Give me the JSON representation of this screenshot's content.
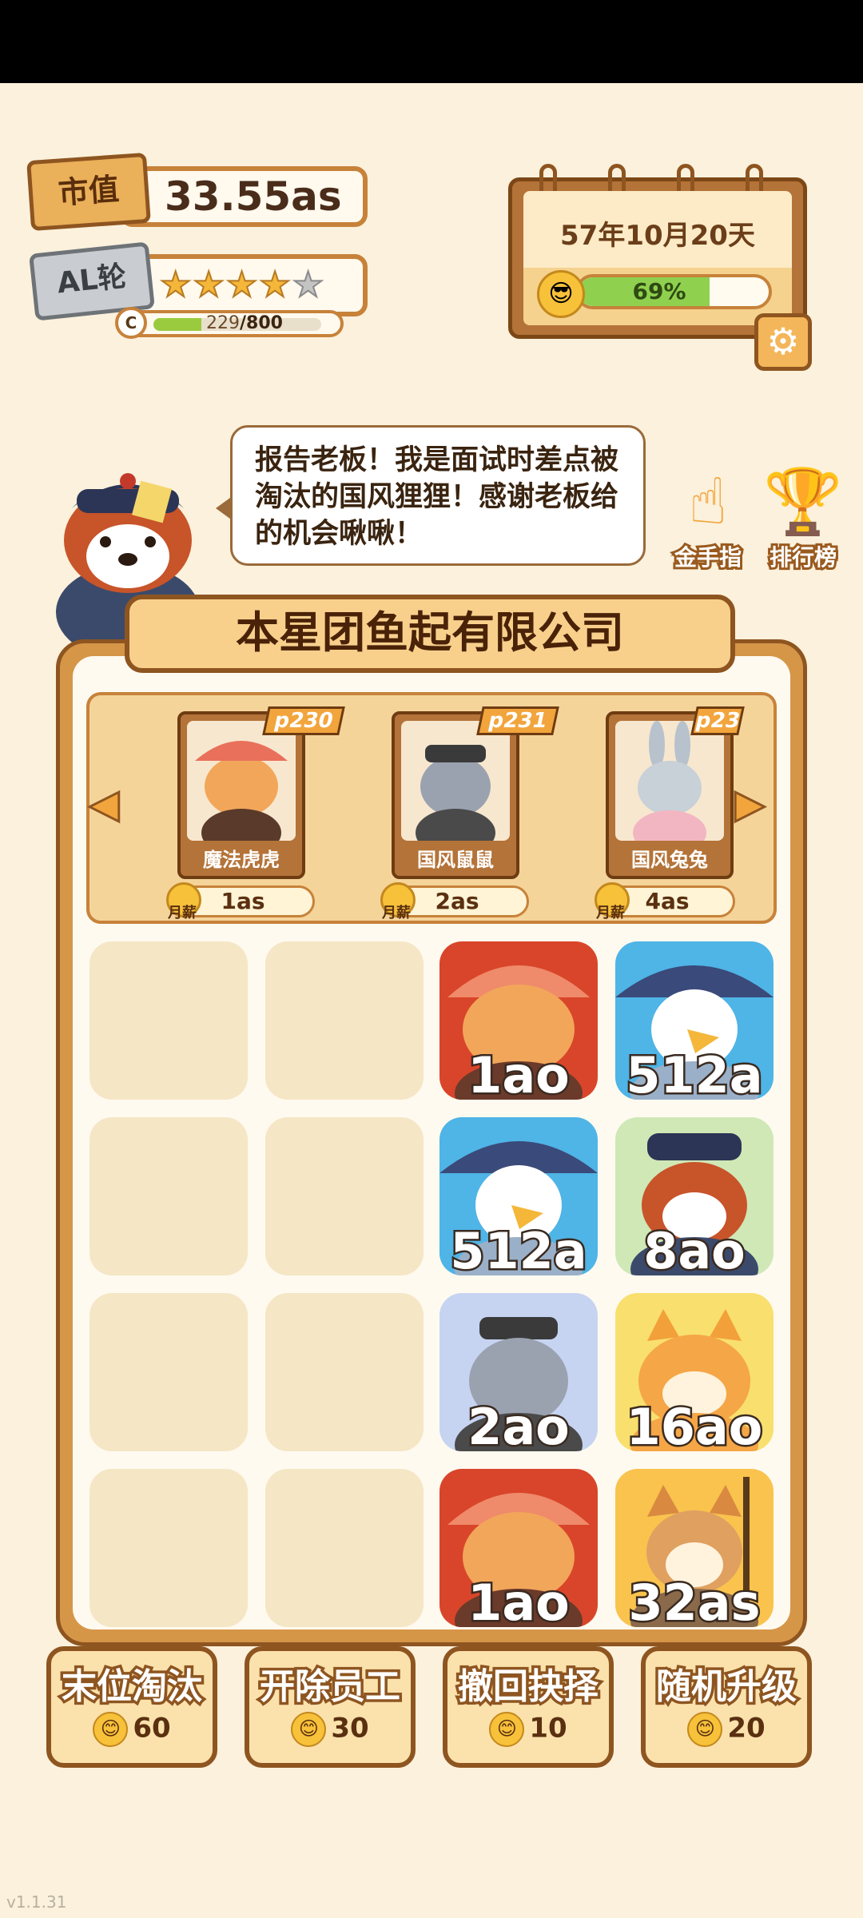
{
  "header": {
    "market_value_label": "市值",
    "market_value": "33.55as",
    "ai_round_label": "AL轮",
    "stars_filled": 4,
    "stars_total": 5,
    "xp_current": "229",
    "xp_max": "/800",
    "xp_fraction": 0.286,
    "level_badge": "C"
  },
  "calendar": {
    "date": "57年10月20天",
    "mood_percent": "69%",
    "mood_fraction": 0.69,
    "settings_icon": "gear-icon"
  },
  "speech": {
    "text": "报告老板！我是面试时差点被淘汰的国风狸狸！感谢老板给的机会啾啾！"
  },
  "side_buttons": {
    "gold_finger": "金手指",
    "leaderboard": "排行榜"
  },
  "company": {
    "name": "本星团鱼起有限公司"
  },
  "shop": {
    "salary_label": "月薪",
    "items": [
      {
        "tag": "p230",
        "name": "魔法虎虎",
        "price": "1as"
      },
      {
        "tag": "p231",
        "name": "国风鼠鼠",
        "price": "2as"
      },
      {
        "tag": "p23",
        "name": "国风兔兔",
        "price": "4as"
      }
    ]
  },
  "grid": {
    "tiles": {
      "r0c2": "1ao",
      "r0c3": "512a",
      "r1c2": "512a",
      "r1c3": "8ao",
      "r2c2": "2ao",
      "r2c3": "16ao",
      "r3c2": "1ao",
      "r3c3": "32as"
    }
  },
  "actions": [
    {
      "label": "末位淘汰",
      "cost": "60"
    },
    {
      "label": "开除员工",
      "cost": "30"
    },
    {
      "label": "撤回抉择",
      "cost": "10"
    },
    {
      "label": "随机升级",
      "cost": "20"
    }
  ],
  "colors": {
    "background": "#fbf1dc",
    "accent_orange": "#f2a53c",
    "frame_brown": "#8e5520",
    "mood_green": "#8fd14f"
  },
  "version": "v1.1.31"
}
